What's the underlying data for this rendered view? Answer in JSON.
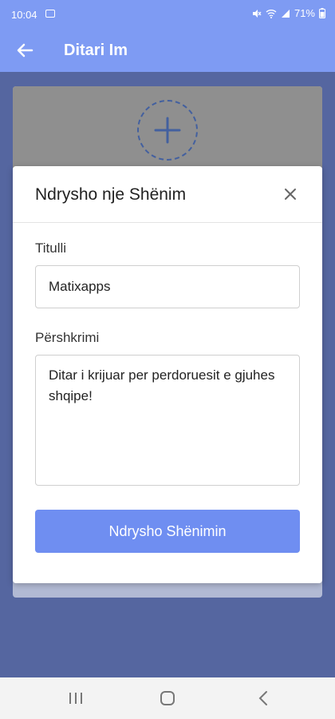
{
  "status_bar": {
    "time": "10:04",
    "battery": "71%"
  },
  "app_bar": {
    "title": "Ditari Im"
  },
  "dialog": {
    "title": "Ndrysho nje Shënim",
    "title_label": "Titulli",
    "title_value": "Matixapps",
    "description_label": "Përshkrimi",
    "description_value": "Ditar i krijuar per perdoruesit e gjuhes shqipe!",
    "submit_label": "Ndrysho Shënimin"
  },
  "colors": {
    "app_bar": "#7e9bf3",
    "button": "#6f8ef1",
    "backdrop": "#5566a0"
  },
  "icons": [
    "image-icon",
    "mute-icon",
    "wifi-icon",
    "signal-icon",
    "battery-icon",
    "back-arrow-icon",
    "add-icon",
    "close-icon",
    "recents-icon",
    "home-icon",
    "back-icon"
  ]
}
